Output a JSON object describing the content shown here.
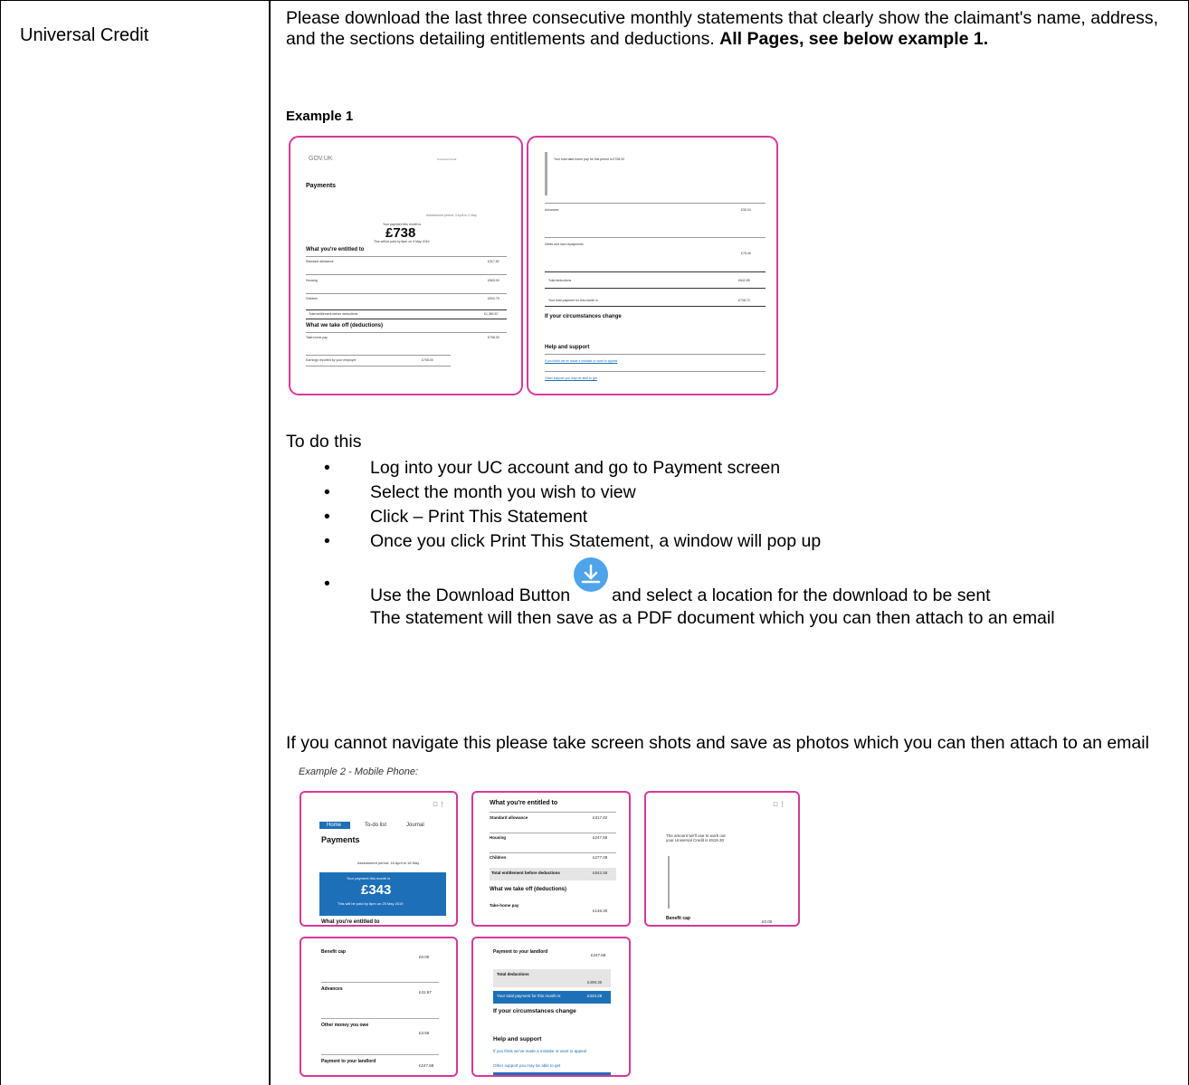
{
  "table": {
    "left_label": "Universal Credit",
    "intro_text": "Please download the last three consecutive monthly statements that clearly show the claimant's name, address, and the sections detailing entitlements and deductions. ",
    "intro_bold": "All Pages, see below example 1.",
    "example1_title": "Example 1",
    "todo_heading": "To do this",
    "steps": [
      "Log into your UC account and go to Payment screen",
      "Select the month you wish to view",
      "Click – Print This Statement",
      "Once you click Print This Statement, a window will pop up"
    ],
    "step5_before": "Use the Download Button",
    "step5_after": "and select a location for the download to be sent",
    "step5_cont": "The statement will then save as a PDF document which you can then attach to an email",
    "download_icon": "download-arrow-icon",
    "fallback_text": "If you cannot navigate this please take screen shots and save as photos which you can then attach to an email",
    "example2_title": "Example 2 - Mobile Phone:"
  },
  "example1": {
    "page1": {
      "logo": "GOV.UK",
      "header_right": "Universal Credit",
      "title": "Payments",
      "assessment": "Assessment period: 3 April to 2 May",
      "pay_label": "Your payment this month is",
      "amount": "£738",
      "paid_by": "This will be paid by 8pm on 9 May 2019",
      "entitled_heading": "What you're entitled to",
      "rows": [
        {
          "label": "Standard allowance",
          "value": "£317.82"
        },
        {
          "label": "Housing",
          "value": "£563.00"
        },
        {
          "label": "Children",
          "value": "£500.75"
        },
        {
          "label": "Total entitlement before deductions",
          "value": "£1,380.57"
        }
      ],
      "deductions_heading": "What we take off (deductions)",
      "take_home": {
        "label": "Take-home pay",
        "value": "£708.00"
      },
      "earnings": {
        "label": "Earnings reported by your employer",
        "value": "£708.00"
      }
    },
    "page2": {
      "take_home_note": "Your total take-home pay for this period is £708.00",
      "advances": {
        "label": "Advances",
        "value": "£33.34"
      },
      "debts": {
        "label": "Debts and loan repayments",
        "value": "£76.46"
      },
      "total_deductions": {
        "label": "Total deductions",
        "value": "£642.85"
      },
      "total_payment": {
        "label": "Your total payment for this month is",
        "value": "£738.72"
      },
      "circumstances_heading": "If your circumstances change",
      "help_heading": "Help and support",
      "link1": "If you think we've made a mistake or want to appeal",
      "link2": "Other support you may be able to get"
    }
  },
  "example2": {
    "phone1": {
      "tabs": [
        "Home",
        "To-do list",
        "Journal"
      ],
      "title": "Payments",
      "assessment": "Assessment period: 18 April to 18 May",
      "pay_label": "Your payment this month is",
      "amount": "£343",
      "paid_by": "This will be paid by 8pm on 25 May 2019",
      "footer": "What you're entitled to"
    },
    "phone2": {
      "heading": "What you're entitled to",
      "rows": [
        {
          "label": "Standard allowance",
          "value": "£317.82"
        },
        {
          "label": "Housing",
          "value": "£247.68"
        },
        {
          "label": "Children",
          "value": "£277.08"
        },
        {
          "label": "Total entitlement before deductions",
          "value": "£842.58"
        }
      ],
      "deductions_heading": "What we take off (deductions)",
      "take_home": {
        "label": "Take-home pay",
        "value": "£146.30"
      }
    },
    "phone3": {
      "line1": "The amount we'll use to work out your Universal Credit is £519.30",
      "benefit_cap": {
        "label": "Benefit cap",
        "value": "£0.00"
      }
    },
    "phone4": {
      "benefit_cap": {
        "label": "Benefit cap",
        "value": "£0.00"
      },
      "advances": {
        "label": "Advances",
        "value": "£41.67"
      },
      "other_money": {
        "label": "Other money you owe",
        "value": "£3.56"
      },
      "landlord": {
        "label": "Payment to your landlord",
        "value": "£247.68"
      }
    },
    "phone5": {
      "landlord": {
        "label": "Payment to your landlord",
        "value": "£247.68"
      },
      "total_deductions": {
        "label": "Total deductions",
        "value": "£499.30"
      },
      "total_payment": {
        "label": "Your total payment for this month is",
        "value": "£343.28"
      },
      "circumstances_heading": "If your circumstances change",
      "help_heading": "Help and support",
      "link1": "If you think we've made a mistake or want to appeal",
      "link2": "Other support you may be able to get"
    }
  }
}
